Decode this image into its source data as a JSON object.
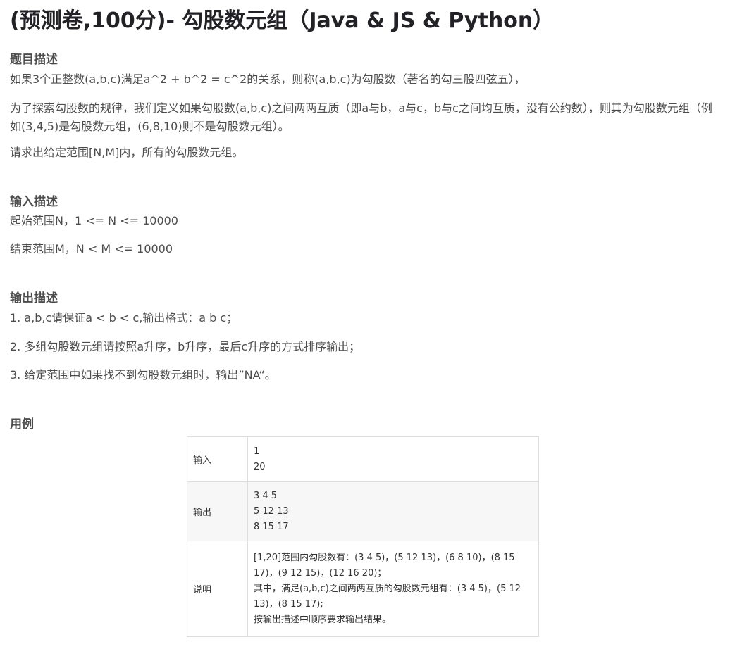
{
  "title": "(预测卷,100分)- 勾股数元组（Java & JS & Python）",
  "sections": {
    "description": {
      "heading": "题目描述",
      "paragraphs": [
        "如果3个正整数(a,b,c)满足a^2 + b^2 = c^2的关系，则称(a,b,c)为勾股数（著名的勾三股四弦五），",
        "为了探索勾股数的规律，我们定义如果勾股数(a,b,c)之间两两互质（即a与b，a与c，b与c之间均互质，没有公约数），则其为勾股数元组（例如(3,4,5)是勾股数元组，(6,8,10)则不是勾股数元组）。",
        "请求出给定范围[N,M]内，所有的勾股数元组。"
      ]
    },
    "input": {
      "heading": "输入描述",
      "paragraphs": [
        "起始范围N，1 <= N <= 10000",
        "结束范围M，N < M <= 10000"
      ]
    },
    "output": {
      "heading": "输出描述",
      "paragraphs": [
        "1. a,b,c请保证a < b < c,输出格式：a b c；",
        "2. 多组勾股数元组请按照a升序，b升序，最后c升序的方式排序输出；",
        "3. 给定范围中如果找不到勾股数元组时，输出”NA“。"
      ]
    },
    "example": {
      "heading": "用例",
      "rows": [
        {
          "label": "输入",
          "lines": [
            "1",
            "20"
          ]
        },
        {
          "label": "输出",
          "lines": [
            "3 4 5",
            "5 12 13",
            "8 15 17"
          ]
        },
        {
          "label": "说明",
          "lines": [
            "[1,20]范围内勾股数有：(3 4 5)，(5 12 13)，(6 8 10)，(8 15",
            "17)，(9 12 15)，(12 16 20)；",
            "其中，满足(a,b,c)之间两两互质的勾股数元组有：(3 4 5)，(5 12",
            "13)，(8 15 17);",
            "按输出描述中顺序要求输出结果。"
          ]
        }
      ]
    }
  }
}
